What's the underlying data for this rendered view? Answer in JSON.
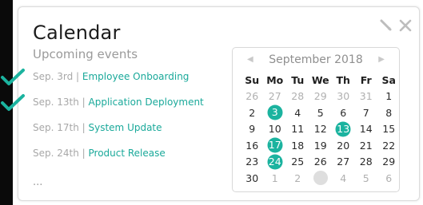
{
  "title": "Calendar",
  "subtitle": "Upcoming events",
  "tools": [
    "pin-icon",
    "close-icon"
  ],
  "events": [
    {
      "date": "Sep. 3rd",
      "name": "Employee Onboarding",
      "checked": true
    },
    {
      "date": "Sep. 13th",
      "name": "Application Deployment",
      "checked": true
    },
    {
      "date": "Sep. 17th",
      "name": "System Update",
      "checked": false
    },
    {
      "date": "Sep. 24th",
      "name": "Product Release",
      "checked": false
    }
  ],
  "more_text": "...",
  "calendar": {
    "month": "September 2018",
    "prev": "◀",
    "next": "▶",
    "weekdays": [
      "Su",
      "Mo",
      "Tu",
      "We",
      "Th",
      "Fr",
      "Sa"
    ],
    "days": [
      [
        "26",
        "27",
        "28",
        "29",
        "30",
        "31",
        "1"
      ],
      [
        "2",
        "3",
        "4",
        "5",
        "6",
        "7",
        "8"
      ],
      [
        "9",
        "10",
        "11",
        "12",
        "13",
        "14",
        "15"
      ],
      [
        "16",
        "17",
        "18",
        "19",
        "20",
        "21",
        "22"
      ],
      [
        "23",
        "24",
        "25",
        "26",
        "27",
        "28",
        "29"
      ],
      [
        "30",
        "1",
        "2",
        "",
        "4",
        "5",
        "6"
      ]
    ],
    "event_days": [
      "3",
      "13",
      "17",
      "24"
    ],
    "accent_color": "#1bb39f"
  }
}
